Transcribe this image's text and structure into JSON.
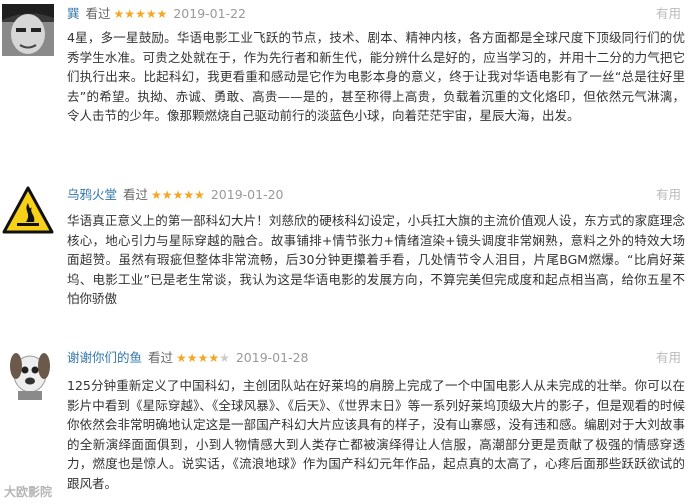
{
  "reviews": [
    {
      "user": "巽",
      "watched": "看过",
      "rating": 5,
      "date": "2019-01-22",
      "useful": "有用",
      "avatar": "bw-face-photo",
      "text": "4星，多一星鼓励。华语电影工业飞跃的节点，技术、剧本、精神内核，各方面都是全球尺度下顶级同行们的优秀学生水准。可贵之处就在于，作为先行者和新生代，能分辨什么是好的，应当学习的，并用十二分的力气把它们执行出来。比起科幻，我更看重和感动是它作为电影本身的意义，终于让我对华语电影有了一丝“总是往好里去”的希望。执拗、赤诚、勇敢、高贵——是的，甚至称得上高贵，负载着沉重的文化烙印，但依然元气淋漓，令人击节的少年。像那颗燃烧自己驱动前行的淡蓝色小球，向着茫茫宇宙，星辰大海，出发。"
    },
    {
      "user": "乌鸦火堂",
      "watched": "看过",
      "rating": 5,
      "date": "2019-01-20",
      "useful": "有用",
      "avatar": "flammable-warning-sign",
      "text": "华语真正意义上的第一部科幻大片！刘慈欣的硬核科幻设定，小兵扛大旗的主流价值观人设，东方式的家庭理念核心，地心引力与星际穿越的融合。故事铺排+情节张力+情绪渲染+镜头调度非常娴熟，意料之外的特效大场面超赞。虽然有瑕疵但整体非常流畅，后30分钟更攥着手看，几处情节令人泪目，片尾BGM燃爆。“比肩好莱坞、电影工业”已是老生常谈，我认为这是华语电影的发展方向，不算完美但完成度和起点相当高，给你五星不怕你骄傲"
    },
    {
      "user": "谢谢你们的鱼",
      "watched": "看过",
      "rating": 4,
      "date": "2019-01-28",
      "useful": "有用",
      "avatar": "clay-dog-figure",
      "text": "125分钟重新定义了中国科幻，主创团队站在好莱坞的肩膀上完成了一个中国电影人从未完成的壮举。你可以在影片中看到《星际穿越》、《全球风暴》、《后天》、《世界末日》等一系列好莱坞顶级大片的影子，但是观看的时候你依然会非常明确地认定这是一部国产科幻大片应该具有的样子，没有山寨感，没有违和感。编剧对于大刘故事的全新演绎面面俱到，小到人物情感大到人类存亡都被演绎得让人信服，高潮部分更是贡献了极强的情感穿透力，燃度也是惊人。说实话，《流浪地球》作为国产科幻元年作品，起点真的太高了，心疼后面那些跃跃欲试的跟风者。"
    }
  ],
  "watermark": "大欧影院",
  "colors": {
    "user": "#3377aa",
    "star": "#f5a623",
    "date": "#999999",
    "useful": "#bbbbbb"
  }
}
